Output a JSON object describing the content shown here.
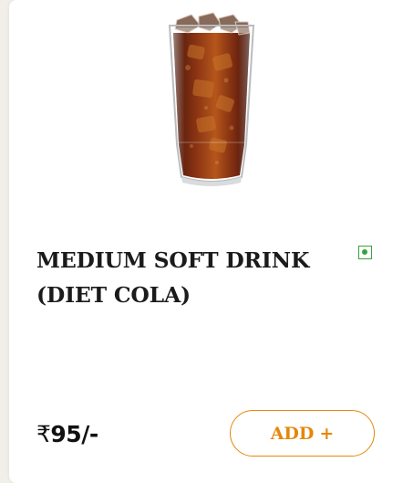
{
  "product": {
    "title": "MEDIUM SOFT DRINK (DIET COLA)",
    "image_icon": "cola-glass-icon",
    "veg_icon": "veg-indicator-icon",
    "price": {
      "symbol": "₹",
      "amount": "95/-"
    }
  },
  "actions": {
    "add_label": "ADD",
    "add_symbol": "+"
  },
  "colors": {
    "accent": "#e5870a",
    "veg": "#3aa13a",
    "title": "#1b1b1b"
  }
}
